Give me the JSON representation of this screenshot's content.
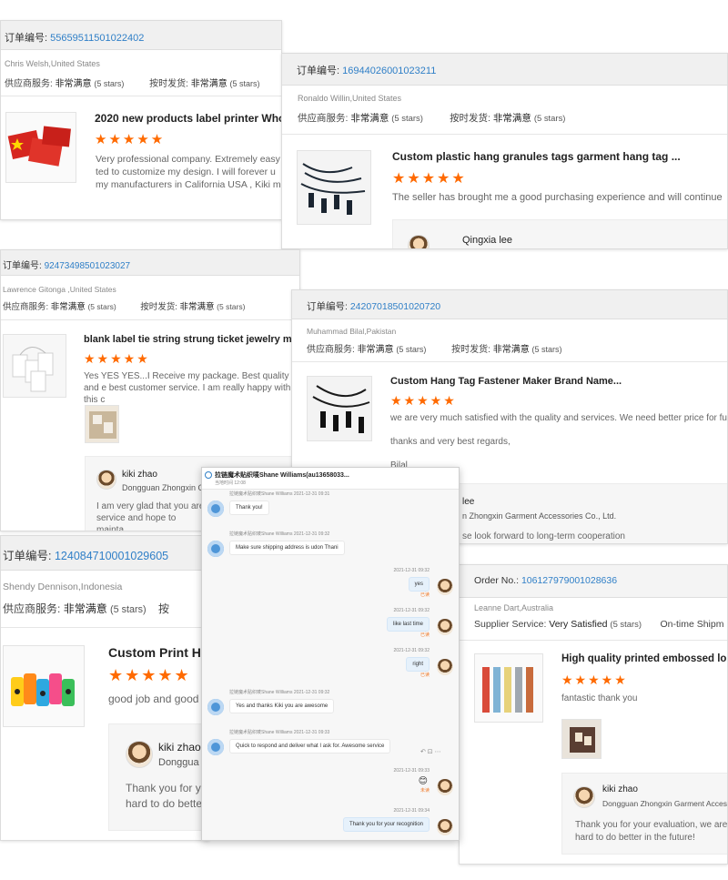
{
  "labels": {
    "order_prefix_cn": "订单编号:",
    "order_prefix_en": "Order No.:",
    "supplier_service_cn": "供应商服务:",
    "ontime_cn": "按时发货:",
    "very_satisfied_cn": "非常满意",
    "supplier_service_en": "Supplier Service:",
    "very_satisfied_en": "Very Satisfied",
    "ontime_en": "On-time Shipm",
    "five_stars": "(5 stars)",
    "star_glyphs": "★★★★★"
  },
  "card1": {
    "order_no": "55659511501022402",
    "buyer": "Chris Welsh,United States",
    "title": "2020 new products label printer Whol",
    "review": "Very professional company. Extremely easy ted to customize my design. I will forever u my manufacturers in California USA , Kiki m"
  },
  "card2": {
    "order_no": "16944026001023211",
    "buyer": "Ronaldo Willin,United States",
    "title": "Custom plastic hang granules tags garment hang tag ...",
    "review": "The seller has brought me a good purchasing experience and will continue",
    "reply_name": "Qingxia lee"
  },
  "card3": {
    "order_no": "92473498501023027",
    "buyer": "Lawrence Gitonga ,United States",
    "title": "blank label tie string strung ticket jewelry merc",
    "review": "Yes YES YES...I Receive my package. Best quality and e best customer service.  I am really happy with this c",
    "reply_name": "kiki zhao",
    "reply_company": "Dongguan Zhongxin Ga",
    "reply_text": "I am very glad that you are service and hope to mainta"
  },
  "card4": {
    "order_no": "24207018501020720",
    "buyer": "Muhammad Bilal,Pakistan",
    "title": "Custom Hang Tag Fastener Maker Brand Name...",
    "review_1": "we are very much satisfied with the quality and services. We need better price for futu",
    "review_2": "thanks and very best regards,",
    "review_3": "Bilal",
    "reply_name": "lee",
    "reply_company": "n Zhongxin Garment Accessories Co., Ltd.",
    "reply_text": "se look forward to long-term cooperation"
  },
  "card5": {
    "order_no": "124084710001029605",
    "buyer": "Shendy Dennison,Indonesia",
    "ontime_partial": "按",
    "title": "Custom Print Ha",
    "review": "good job and good",
    "reply_name": "kiki zhao",
    "reply_company": "Donggua",
    "reply_text": "Thank you for y hard to do bette"
  },
  "card6": {
    "order_no": "106127979001028636",
    "buyer": "Leanne Dart,Australia",
    "title": "High quality printed embossed logo",
    "review": "fantastic thank you",
    "reply_name": "kiki zhao",
    "reply_company": "Dongguan Zhongxin Garment Acces",
    "reply_text": "Thank you for your evaluation, we are hard to do better in the future!"
  },
  "chat": {
    "title": "拉链魔术贴织唛Shane  Williams(au13658033...",
    "subtitle": "当地时间 12:08",
    "messages": [
      {
        "side": "left",
        "meta": "拉链魔术贴织唛Shane Williams   2021-12-31 09:31",
        "text": "Thank you!"
      },
      {
        "side": "left",
        "meta": "拉链魔术贴织唛Shane Williams   2021-12-31 09:32",
        "text": "Make sure shipping address is udon Thani"
      },
      {
        "side": "right",
        "meta": "2021-12-31 09:32",
        "text": "yes",
        "status": "已读"
      },
      {
        "side": "right",
        "meta": "2021-12-31 09:32",
        "text": "like last time",
        "status": "已读"
      },
      {
        "side": "right",
        "meta": "2021-12-31 09:32",
        "text": "right",
        "status": "已读"
      },
      {
        "side": "left",
        "meta": "拉链魔术贴织唛Shane Williams   2021-12-31 09:32",
        "text": "Yes and thanks Kiki you are awesome"
      },
      {
        "side": "left",
        "meta": "拉链魔术贴织唛Shane Williams   2021-12-31 09:33",
        "text": "Quick to respond and deliver what I ask for. Awesome service"
      },
      {
        "side": "right",
        "meta": "2021-12-31 09:33",
        "text": "😊",
        "status": "未读"
      },
      {
        "side": "right",
        "meta": "2021-12-31 09:34",
        "text": "Thank you for your recognition",
        "status": ""
      }
    ]
  }
}
